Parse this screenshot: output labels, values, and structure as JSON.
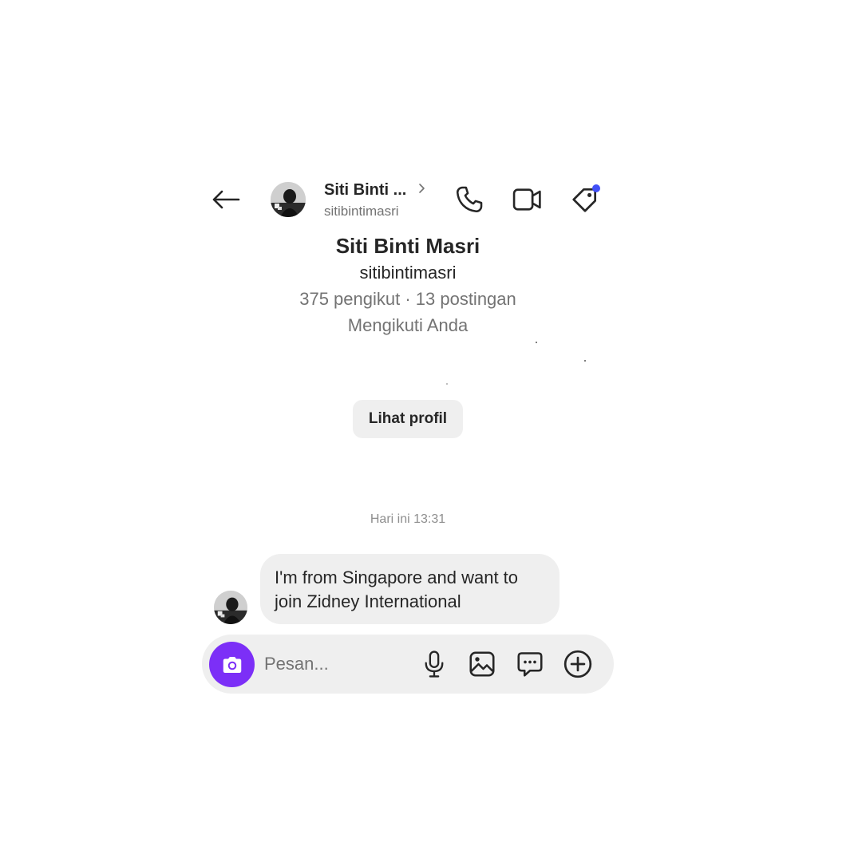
{
  "header": {
    "display_name": "Siti Binti ...",
    "username": "sitibintimasri",
    "back_icon": "arrow-left-icon",
    "chevron_icon": "chevron-right-icon",
    "call_icon": "phone-icon",
    "video_icon": "video-camera-icon",
    "tag_icon": "tag-icon",
    "notification_color": "#4150f7"
  },
  "profile": {
    "full_name": "Siti Binti Masri",
    "username": "sitibintimasri",
    "stats": "375 pengikut · 13 postingan",
    "follow_status": "Mengikuti Anda",
    "view_profile_label": "Lihat profil"
  },
  "conversation": {
    "timestamp": "Hari ini 13:31",
    "messages": [
      {
        "line1": "I'm from Singapore and want to",
        "line2": "join Zidney International"
      }
    ]
  },
  "composer": {
    "placeholder": "Pesan...",
    "camera_icon": "camera-icon",
    "mic_icon": "microphone-icon",
    "gallery_icon": "image-icon",
    "sticker_icon": "chat-bubble-icon",
    "plus_icon": "plus-circle-icon",
    "accent_color": "#7c2ff7"
  }
}
